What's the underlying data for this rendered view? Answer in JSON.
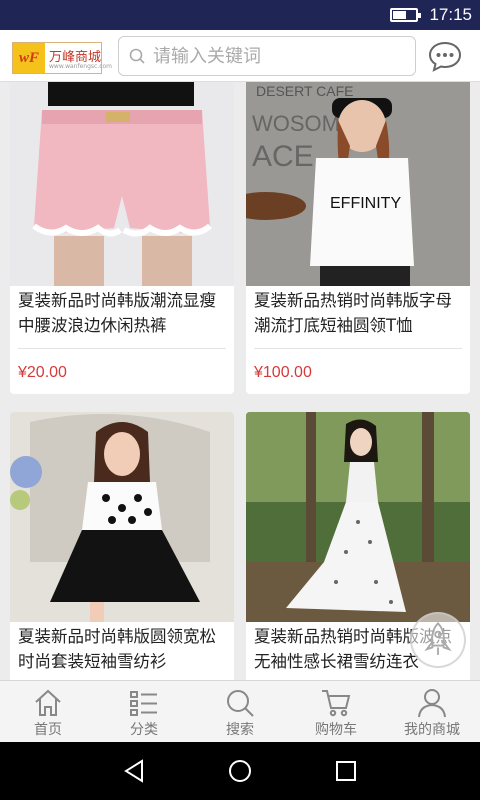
{
  "status_bar": {
    "time": "17:15",
    "battery_level": 0.55
  },
  "header": {
    "logo": {
      "mark": "wF",
      "brand": "万峰商城",
      "url": "www.wanfengsc.com"
    },
    "search_placeholder": "请输入关键词",
    "icons": {
      "search": "search-icon",
      "message": "chat-bubble-icon"
    }
  },
  "products": [
    {
      "title": "夏装新品时尚韩版潮流显瘦中腰波浪边休闲热裤",
      "price": "¥20.00",
      "image": "pink-shorts"
    },
    {
      "title": "夏装新品热销时尚韩版字母潮流打底短袖圆领T恤",
      "price": "¥100.00",
      "image": "white-tshirt"
    },
    {
      "title": "夏装新品时尚韩版圆领宽松时尚套装短袖雪纺衫",
      "price": "",
      "image": "polka-dot-blouse-black-skirt"
    },
    {
      "title": "夏装新品热销时尚韩版波点无袖性感长裙雪纺连衣",
      "price": "",
      "image": "white-dotted-maxi-dress"
    }
  ],
  "floating_button": {
    "icon": "rocket-icon"
  },
  "tabbar": [
    {
      "label": "首页",
      "icon": "home-icon"
    },
    {
      "label": "分类",
      "icon": "category-list-icon"
    },
    {
      "label": "搜索",
      "icon": "search-icon"
    },
    {
      "label": "购物车",
      "icon": "cart-icon"
    },
    {
      "label": "我的商城",
      "icon": "user-icon"
    }
  ],
  "colors": {
    "status_bar": "#1f2554",
    "price": "#d43b3b",
    "tab_icon": "#888888"
  }
}
